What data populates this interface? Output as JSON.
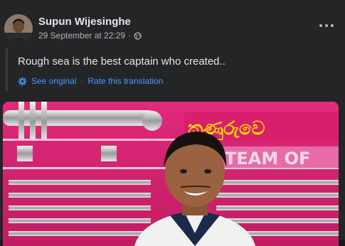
{
  "post": {
    "author": "Supun Wijesinghe",
    "timestamp": "29 September at 22:29",
    "separator": "·",
    "text": "Rough sea is the best captain who created..",
    "see_original": "See original",
    "rate_translation": "Rate this translation",
    "dot": "·"
  },
  "photo": {
    "sign_text": "කුණුරුවෙ",
    "team_text": "TEAM OF"
  },
  "icons": {
    "privacy": "globe-icon",
    "translate": "gear-icon",
    "menu": "more-options-icon"
  },
  "colors": {
    "background": "#18191a",
    "card": "#242526",
    "link": "#4599ff",
    "secondary_text": "#b0b3b8"
  }
}
